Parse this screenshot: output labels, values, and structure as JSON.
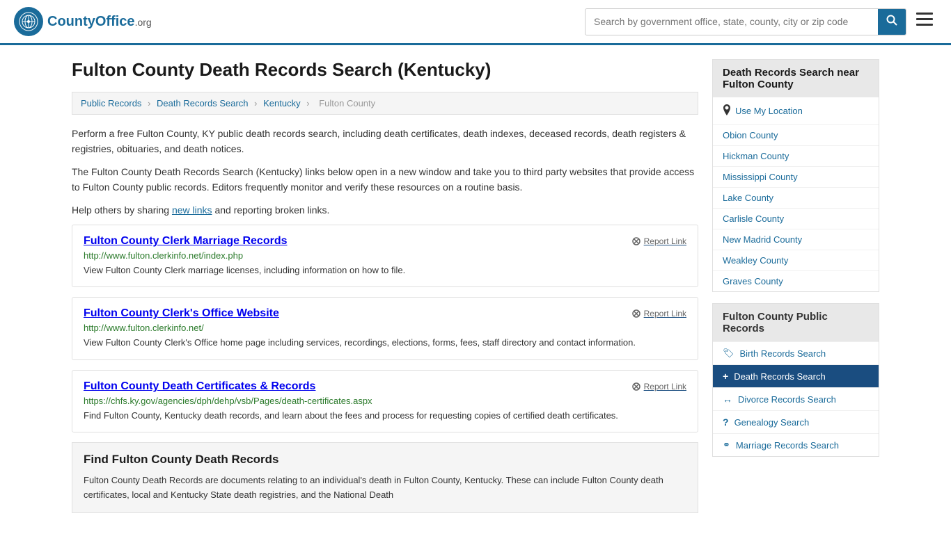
{
  "header": {
    "logo_icon": "🌐",
    "logo_name": "CountyOffice",
    "logo_suffix": ".org",
    "search_placeholder": "Search by government office, state, county, city or zip code",
    "search_btn_icon": "🔍"
  },
  "page": {
    "title": "Fulton County Death Records Search (Kentucky)"
  },
  "breadcrumb": {
    "items": [
      "Public Records",
      "Death Records Search",
      "Kentucky",
      "Fulton County"
    ]
  },
  "intro": {
    "paragraph1": "Perform a free Fulton County, KY public death records search, including death certificates, death indexes, deceased records, death registers & registries, obituaries, and death notices.",
    "paragraph2": "The Fulton County Death Records Search (Kentucky) links below open in a new window and take you to third party websites that provide access to Fulton County public records. Editors frequently monitor and verify these resources on a routine basis.",
    "paragraph3_pre": "Help others by sharing ",
    "new_links_text": "new links",
    "paragraph3_post": " and reporting broken links."
  },
  "results": [
    {
      "title": "Fulton County Clerk Marriage Records",
      "url": "http://www.fulton.clerkinfo.net/index.php",
      "desc": "View Fulton County Clerk marriage licenses, including information on how to file.",
      "report_label": "Report Link"
    },
    {
      "title": "Fulton County Clerk's Office Website",
      "url": "http://www.fulton.clerkinfo.net/",
      "desc": "View Fulton County Clerk's Office home page including services, recordings, elections, forms, fees, staff directory and contact information.",
      "report_label": "Report Link"
    },
    {
      "title": "Fulton County Death Certificates & Records",
      "url": "https://chfs.ky.gov/agencies/dph/dehp/vsb/Pages/death-certificates.aspx",
      "desc": "Find Fulton County, Kentucky death records, and learn about the fees and process for requesting copies of certified death certificates.",
      "report_label": "Report Link"
    }
  ],
  "find_section": {
    "title": "Find Fulton County Death Records",
    "paragraph": "Fulton County Death Records are documents relating to an individual's death in Fulton County, Kentucky. These can include Fulton County death certificates, local and Kentucky State death registries, and the National Death"
  },
  "sidebar": {
    "nearby_header": "Death Records Search near Fulton County",
    "use_my_location": "Use My Location",
    "nearby_counties": [
      "Obion County",
      "Hickman County",
      "Mississippi County",
      "Lake County",
      "Carlisle County",
      "New Madrid County",
      "Weakley County",
      "Graves County"
    ],
    "public_records_header": "Fulton County Public Records",
    "public_records": [
      {
        "label": "Birth Records Search",
        "icon": "birth",
        "active": false
      },
      {
        "label": "Death Records Search",
        "icon": "death",
        "active": true
      },
      {
        "label": "Divorce Records Search",
        "icon": "divorce",
        "active": false
      },
      {
        "label": "Genealogy Search",
        "icon": "genealogy",
        "active": false
      },
      {
        "label": "Marriage Records Search",
        "icon": "marriage",
        "active": false
      }
    ]
  }
}
